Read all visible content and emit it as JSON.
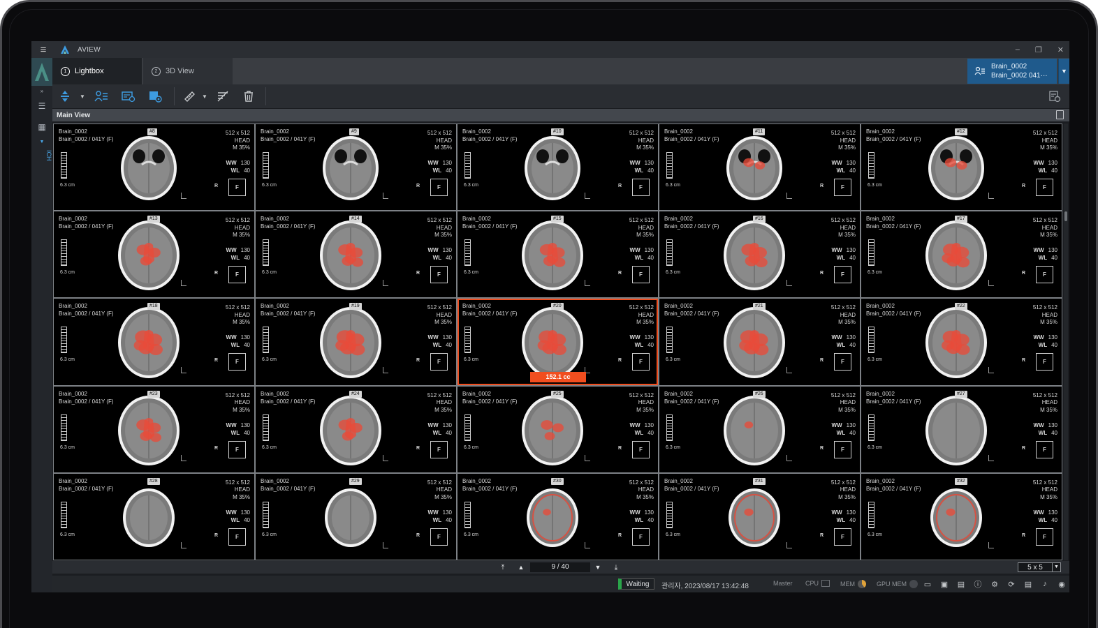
{
  "app": {
    "title": "AVIEW"
  },
  "window": {
    "minimize": "–",
    "restore": "❐",
    "close": "✕"
  },
  "rail": {
    "ich_label": "ICH"
  },
  "tabs": [
    {
      "label": "Lightbox",
      "index": "1"
    },
    {
      "label": "3D View",
      "index": "2"
    }
  ],
  "patient": {
    "line1": "Brain_0002",
    "line2": "Brain_0002 041···"
  },
  "main_view": {
    "title": "Main View"
  },
  "cell_common": {
    "patient_id": "Brain_0002",
    "patient_info": "Brain_0002 / 041Y (F)",
    "matrix": "512 x 512",
    "body_part": "HEAD",
    "series": "M 35%",
    "ww_label": "WW",
    "ww_value": "130",
    "wl_label": "WL",
    "wl_value": "40",
    "scale_label": "6.3 cm",
    "orient_r": "R",
    "orient_f": "F"
  },
  "cells": [
    {
      "num": "#8",
      "hem": 0.02
    },
    {
      "num": "#9",
      "hem": 0.05
    },
    {
      "num": "#10",
      "hem": 0.08
    },
    {
      "num": "#11",
      "hem": 0.35
    },
    {
      "num": "#12",
      "hem": 0.4
    },
    {
      "num": "#13",
      "hem": 0.55
    },
    {
      "num": "#14",
      "hem": 0.6
    },
    {
      "num": "#15",
      "hem": 0.65
    },
    {
      "num": "#16",
      "hem": 0.7
    },
    {
      "num": "#17",
      "hem": 0.75
    },
    {
      "num": "#18",
      "hem": 0.85
    },
    {
      "num": "#19",
      "hem": 0.9
    },
    {
      "num": "#20",
      "hem": 0.85,
      "volume": "152.1 cc",
      "selected": true
    },
    {
      "num": "#21",
      "hem": 0.9
    },
    {
      "num": "#22",
      "hem": 0.8
    },
    {
      "num": "#23",
      "hem": 0.6
    },
    {
      "num": "#24",
      "hem": 0.55
    },
    {
      "num": "#25",
      "hem": 0.45
    },
    {
      "num": "#26",
      "hem": 0.15
    },
    {
      "num": "#27",
      "hem": 0.03
    },
    {
      "num": "#28",
      "hem": 0.02
    },
    {
      "num": "#29",
      "hem": 0.05
    },
    {
      "num": "#30",
      "hem": 0.1
    },
    {
      "num": "#31",
      "hem": 0.2
    },
    {
      "num": "#32",
      "hem": 0.2
    }
  ],
  "pager": {
    "page": "9 / 40",
    "layout": "5 x 5"
  },
  "status": {
    "state": "Waiting",
    "user_time": "관리자, 2023/08/17 13:42:48",
    "master": "Master",
    "cpu": "CPU",
    "mem": "MEM",
    "gpu_mem": "GPU MEM"
  },
  "colors": {
    "accent": "#3d9be0",
    "selection": "#f14e1f",
    "patient_bg": "#1f5a8c",
    "waiting": "#2aa54a"
  }
}
